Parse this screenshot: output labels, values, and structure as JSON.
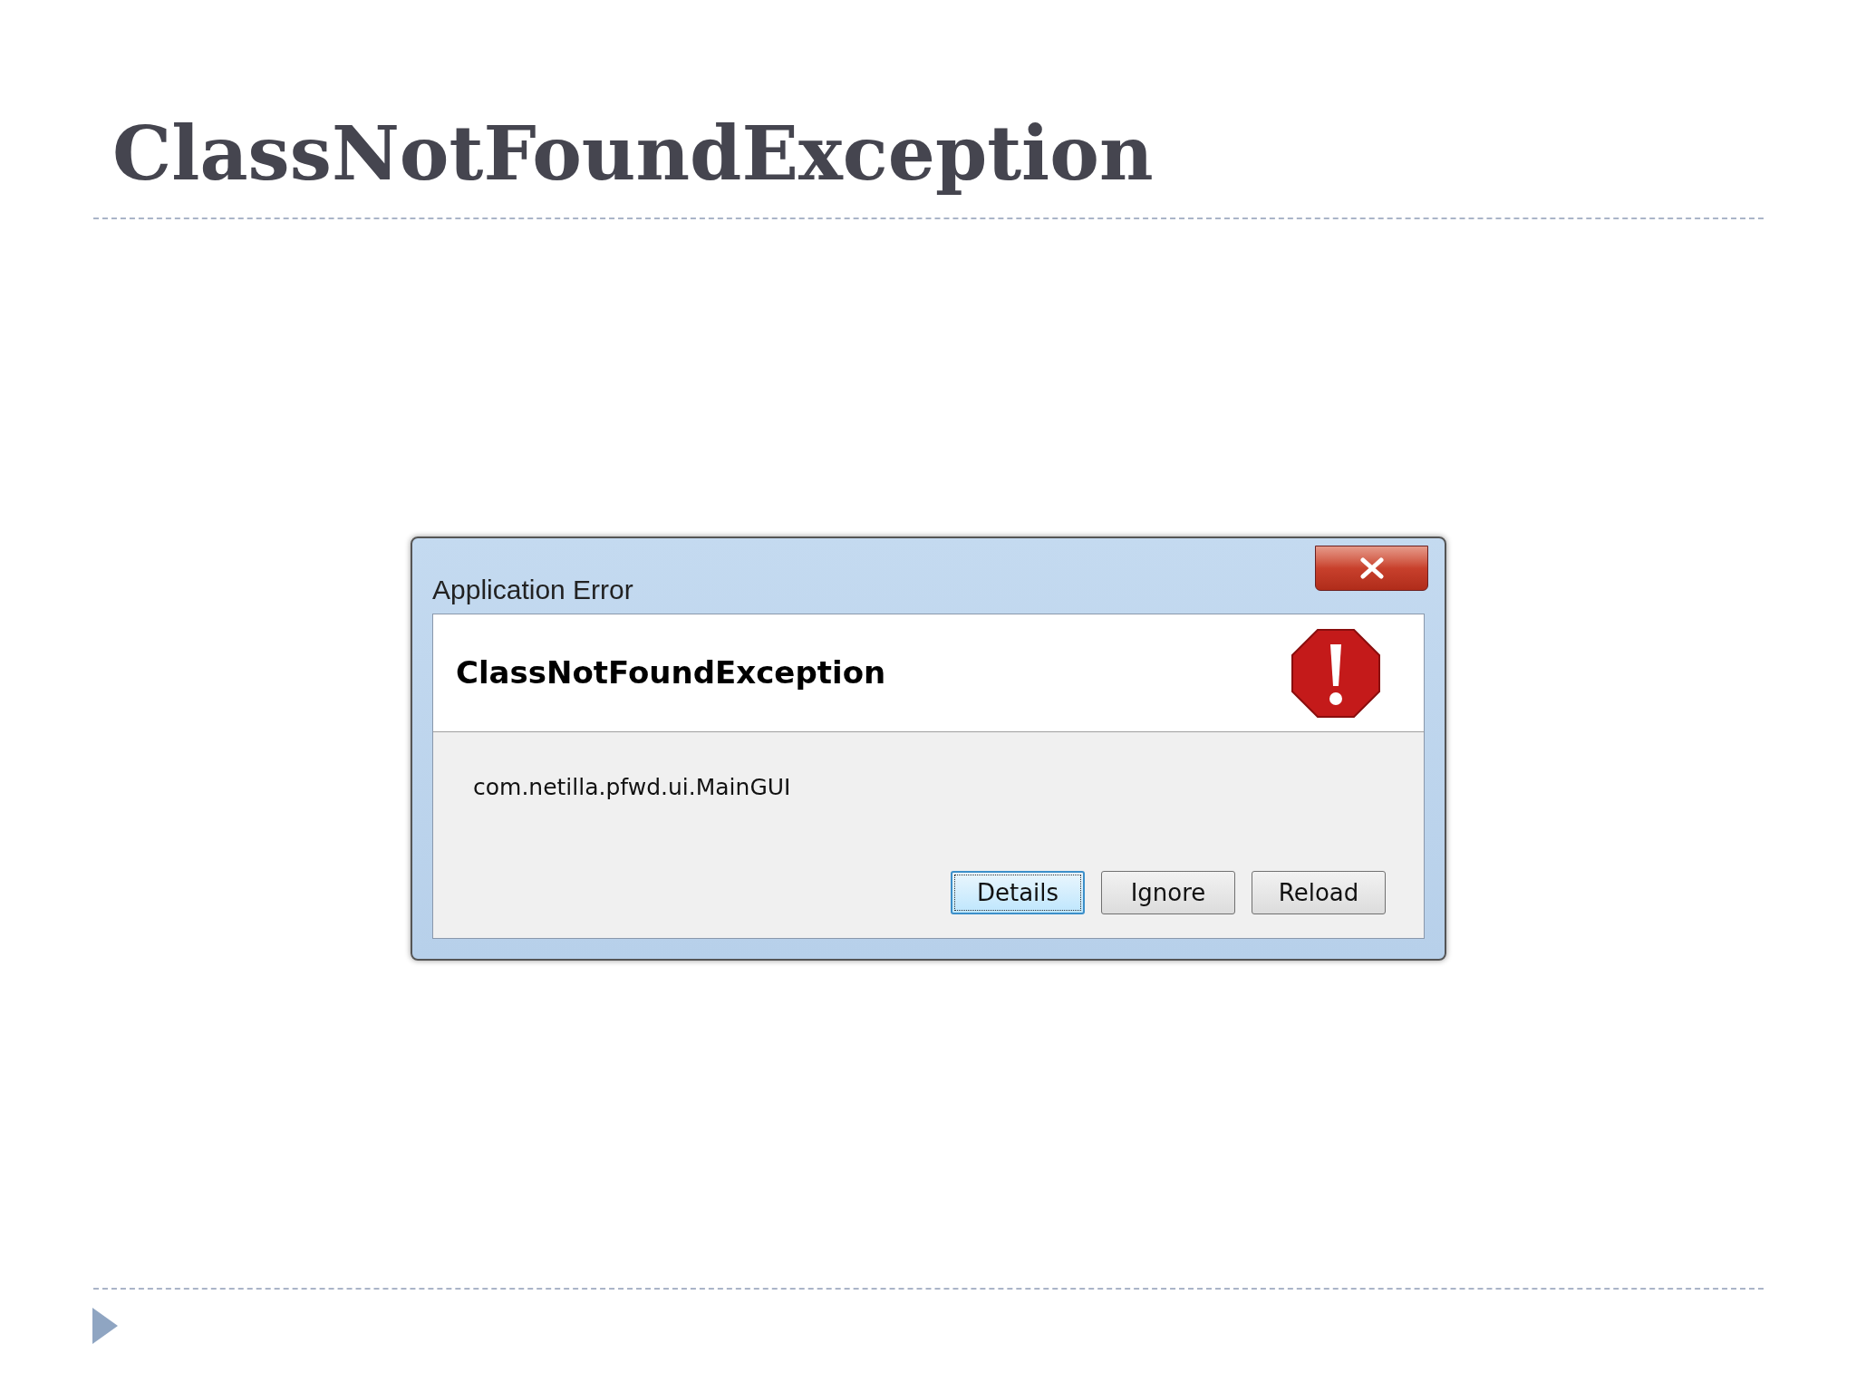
{
  "slide": {
    "title": "ClassNotFoundException"
  },
  "dialog": {
    "title": "Application Error",
    "heading": "ClassNotFoundException",
    "message": "com.netilla.pfwd.ui.MainGUI",
    "buttons": [
      {
        "label": "Details",
        "focused": true
      },
      {
        "label": "Ignore",
        "focused": false
      },
      {
        "label": "Reload",
        "focused": false
      }
    ]
  }
}
